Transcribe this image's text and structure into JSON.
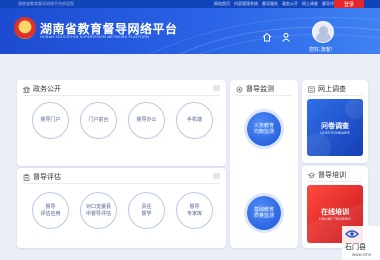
{
  "topbar": {
    "left_text": "湖南省教育督导网络平台欢迎您",
    "links": [
      "网站首页",
      "内容管理系统",
      "督导服务",
      "政务公开",
      "网上调查",
      "督导评估"
    ],
    "login_label": "登录"
  },
  "header": {
    "title": "湖南省教育督导网络平台",
    "subtitle": "HUNAN EDUCATION SUPERVISION NETWORK PLATFORM",
    "greeting": "您好,游客!"
  },
  "zhengwu": {
    "title": "政务公开",
    "items": [
      {
        "label": "督导门户"
      },
      {
        "label": "门户前台"
      },
      {
        "label": "督导办公"
      },
      {
        "label": "手机端"
      }
    ]
  },
  "pinggu": {
    "title": "督导评估",
    "items": [
      {
        "label": "督导\n评估应用"
      },
      {
        "label": "对口支援县\n中督导评估"
      },
      {
        "label": "责任\n督学"
      },
      {
        "label": "督导\n专家库"
      }
    ]
  },
  "jiance": {
    "title": "督导监测",
    "items": [
      {
        "label": "义务教育\n均衡监测"
      },
      {
        "label": "基础教育\n质量监测"
      }
    ]
  },
  "diaocha": {
    "title": "网上调查",
    "card_title": "问卷调查",
    "card_sub": "QUESTIONNAIRE"
  },
  "peixun": {
    "title": "督导培训",
    "card_title": "在线培训",
    "card_sub": "ONLINE TRAINING"
  },
  "watermark": {
    "text": "石门县",
    "sub": "www.sme"
  },
  "colors": {
    "brand_blue": "#1c4bd0",
    "accent_red": "#e5262c",
    "circle_border": "#b8c8ee"
  }
}
